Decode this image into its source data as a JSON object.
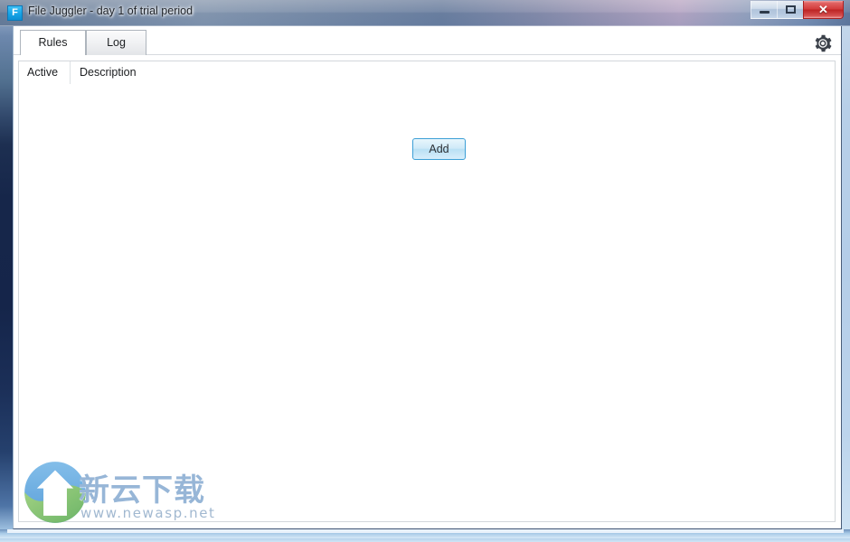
{
  "window": {
    "title": "File Juggler - day 1 of trial period",
    "app_icon_letter": "F",
    "app_icon_name": "file-juggler-app-icon",
    "controls": {
      "minimize_label": "─",
      "maximize_label": "□",
      "close_label": "✕"
    }
  },
  "tabs": [
    {
      "label": "Rules",
      "selected": true
    },
    {
      "label": "Log",
      "selected": false
    }
  ],
  "toolbar": {
    "settings_icon": "gear-icon"
  },
  "rules_panel": {
    "columns": [
      {
        "label": "Active"
      },
      {
        "label": "Description"
      }
    ],
    "rows": [],
    "add_button_label": "Add"
  },
  "watermark": {
    "title_cn": "新云下载",
    "url": "www.newasp.net",
    "logo_name": "newasp-logo"
  },
  "colors": {
    "accent_blue": "#3c9fd6",
    "close_red": "#bc2323",
    "app_icon_blue": "#18a6e8",
    "watermark_blue": "#8fb0d4"
  }
}
